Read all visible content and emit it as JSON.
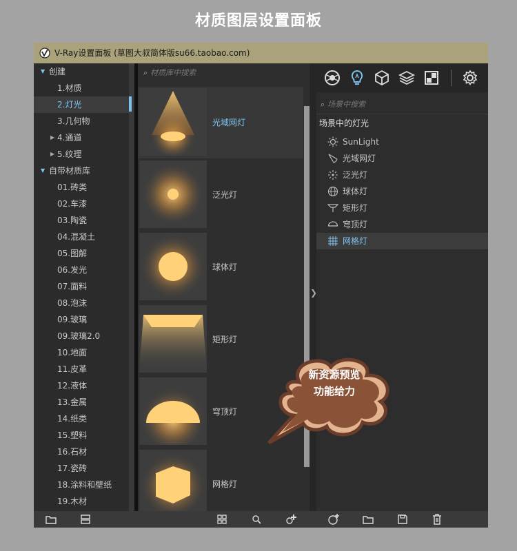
{
  "heading": "材质图层设置面板",
  "window": {
    "title": "V-Ray设置面板   (草图大叔简体版su66.taobao.com)"
  },
  "tree": [
    {
      "label": "创建",
      "level": 0,
      "arrow": "down"
    },
    {
      "label": "1.材质",
      "level": 1
    },
    {
      "label": "2.灯光",
      "level": 1,
      "selected": true
    },
    {
      "label": "3.几何物",
      "level": 1
    },
    {
      "label": "4.通道",
      "level": 1,
      "arrow": "right"
    },
    {
      "label": "5.纹理",
      "level": 1,
      "arrow": "right"
    },
    {
      "label": "自带材质库",
      "level": 0,
      "arrow": "down"
    },
    {
      "label": "01.砖类",
      "level": 1
    },
    {
      "label": "02.车漆",
      "level": 1
    },
    {
      "label": "03.陶瓷",
      "level": 1
    },
    {
      "label": "04.混凝土",
      "level": 1
    },
    {
      "label": "05.图解",
      "level": 1
    },
    {
      "label": "06.发光",
      "level": 1
    },
    {
      "label": "07.面料",
      "level": 1
    },
    {
      "label": "08.泡沫",
      "level": 1
    },
    {
      "label": "09.玻璃",
      "level": 1
    },
    {
      "label": "09.玻璃2.0",
      "level": 1
    },
    {
      "label": "10.地面",
      "level": 1
    },
    {
      "label": "11.皮革",
      "level": 1
    },
    {
      "label": "12.液体",
      "level": 1
    },
    {
      "label": "13.金属",
      "level": 1
    },
    {
      "label": "14.纸类",
      "level": 1
    },
    {
      "label": "15.塑料",
      "level": 1
    },
    {
      "label": "16.石材",
      "level": 1
    },
    {
      "label": "17.瓷砖",
      "level": 1
    },
    {
      "label": "18.涂料和壁纸",
      "level": 1
    },
    {
      "label": "19.木材",
      "level": 1
    }
  ],
  "library": {
    "search_placeholder": "材质库中搜索",
    "items": [
      {
        "label": "光域网灯",
        "kind": "ies",
        "selected": true
      },
      {
        "label": "泛光灯",
        "kind": "omni"
      },
      {
        "label": "球体灯",
        "kind": "sphere"
      },
      {
        "label": "矩形灯",
        "kind": "rect"
      },
      {
        "label": "穹顶灯",
        "kind": "dome"
      },
      {
        "label": "网格灯",
        "kind": "mesh"
      }
    ]
  },
  "scene": {
    "search_placeholder": "场景中搜索",
    "group_title": "场景中的灯光",
    "tabs": [
      "materials-icon",
      "lights-icon",
      "geometry-icon",
      "layers-icon",
      "render-elements-icon",
      "settings-icon"
    ],
    "active_tab": "lights-icon",
    "lights": [
      {
        "label": "SunLight",
        "icon": "sun-icon"
      },
      {
        "label": "光域网灯",
        "icon": "ies-light-icon"
      },
      {
        "label": "泛光灯",
        "icon": "omni-light-icon"
      },
      {
        "label": "球体灯",
        "icon": "sphere-light-icon"
      },
      {
        "label": "矩形灯",
        "icon": "rect-light-icon"
      },
      {
        "label": "穹顶灯",
        "icon": "dome-light-icon"
      },
      {
        "label": "网格灯",
        "icon": "mesh-light-icon",
        "selected": true
      }
    ]
  },
  "callout": {
    "line1": "新资源预览",
    "line2": "功能给力"
  },
  "colors": {
    "accent": "#7ec3f0",
    "glow": "#ffd27a",
    "titlebar": "#a9a27a"
  }
}
